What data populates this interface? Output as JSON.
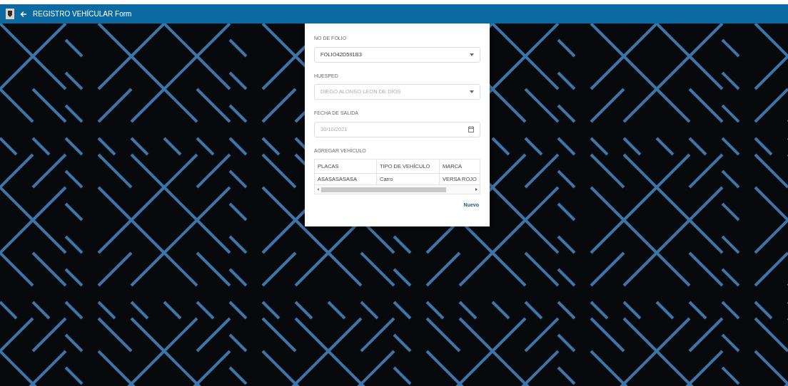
{
  "app_bar": {
    "title": "REGISTRO VEHÍCULAR Form"
  },
  "form": {
    "fields": [
      {
        "label": "NO DE FOLIO",
        "kind": "select",
        "value": "FOLIO42D591B3",
        "disabled": false
      },
      {
        "label": "HUESPED",
        "kind": "select",
        "value": "DIEGO ALONSO LEON DE DIOS",
        "disabled": true
      },
      {
        "label": "FECHA DE SALIDA",
        "kind": "date",
        "value": "30/10/2021",
        "disabled": true
      }
    ],
    "vehicles": {
      "label": "AGREGAR VEHÍCULO",
      "columns": [
        "PLACAS",
        "TIPO DE VEHÍCULO",
        "MARCA"
      ],
      "rows": [
        [
          "ASASASASASA",
          "Carro",
          "VERSA ROJO"
        ]
      ]
    },
    "new_button": "Nuevo"
  }
}
